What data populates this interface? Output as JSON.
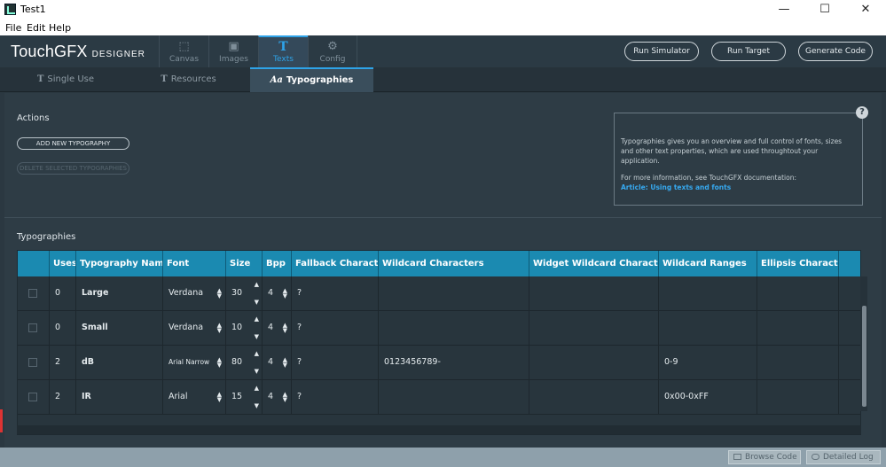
{
  "window": {
    "title": "Test1",
    "minimize": "—",
    "maximize": "☐",
    "close": "✕"
  },
  "menu": [
    "File",
    "Edit",
    "Help"
  ],
  "logo": {
    "main": "TouchGFX",
    "sub": "DESIGNER"
  },
  "nav_tabs": [
    {
      "label": "Canvas",
      "icon": "canvas-icon"
    },
    {
      "label": "Images",
      "icon": "images-icon"
    },
    {
      "label": "Texts",
      "icon": "texts-icon"
    },
    {
      "label": "Config",
      "icon": "gear-icon"
    }
  ],
  "header_buttons": {
    "run_simulator": "Run Simulator",
    "run_target": "Run Target",
    "generate_code": "Generate Code"
  },
  "sub_tabs": {
    "single_use": "Single Use",
    "resources": "Resources",
    "typographies": "Typographies",
    "typo_prefix": "Aa"
  },
  "actions": {
    "title": "Actions",
    "add": "ADD NEW TYPOGRAPHY",
    "delete": "DELETE SELECTED TYPOGRAPHIES"
  },
  "info": {
    "line1": "Typographies gives you an overview and full control of fonts, sizes and other text properties, which are used throughtout your application.",
    "line2": "For more information, see TouchGFX documentation:",
    "link": "Article: Using texts and fonts",
    "help": "?"
  },
  "typographies": {
    "title": "Typographies",
    "columns": [
      "",
      "Uses",
      "Typography Name",
      "Font",
      "Size",
      "Bpp",
      "Fallback Character",
      "Wildcard Characters",
      "Widget Wildcard Characters",
      "Wildcard Ranges",
      "Ellipsis Character"
    ],
    "rows": [
      {
        "uses": "0",
        "name": "Large",
        "font": "Verdana",
        "size": "30",
        "bpp": "4",
        "fallback": "?",
        "wildcard": "",
        "widget_wildcard": "",
        "ranges": "",
        "ellipsis": ""
      },
      {
        "uses": "0",
        "name": "Small",
        "font": "Verdana",
        "size": "10",
        "bpp": "4",
        "fallback": "?",
        "wildcard": "",
        "widget_wildcard": "",
        "ranges": "",
        "ellipsis": ""
      },
      {
        "uses": "2",
        "name": "dB",
        "font": "Arial Narrow",
        "size": "80",
        "bpp": "4",
        "fallback": "?",
        "wildcard": "0123456789-",
        "widget_wildcard": "",
        "ranges": "0-9",
        "ellipsis": ""
      },
      {
        "uses": "2",
        "name": "IR",
        "font": "Arial",
        "size": "15",
        "bpp": "4",
        "fallback": "?",
        "wildcard": "",
        "widget_wildcard": "",
        "ranges": "0x00-0xFF",
        "ellipsis": ""
      }
    ]
  },
  "status": {
    "browse_code": "Browse Code",
    "detailed_log": "Detailed Log"
  },
  "colors": {
    "accent": "#2ea3e8",
    "header": "#1b8ab1",
    "background": "#2e3c45"
  }
}
